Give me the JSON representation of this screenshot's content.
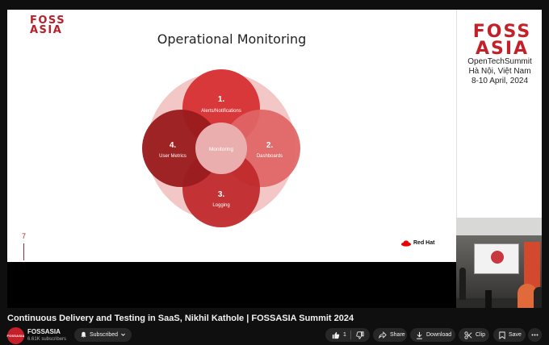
{
  "slide": {
    "logo": "FOSS\nASIA",
    "title": "Operational Monitoring",
    "slide_number": "7",
    "center_label": "Monitoring",
    "items": [
      {
        "num": "1.",
        "label": "Alerts/Notifications"
      },
      {
        "num": "2.",
        "label": "Dashboards"
      },
      {
        "num": "3.",
        "label": "Logging"
      },
      {
        "num": "4.",
        "label": "User Metrics"
      }
    ],
    "vendor_logo": "Red Hat"
  },
  "side_panel": {
    "logo": "FOSS\nASIA",
    "event_name": "OpenTechSummit",
    "location": "Hà Nội, Việt Nam",
    "dates": "8-10 April, 2024"
  },
  "video": {
    "title": "Continuous Delivery and Testing in SaaS, Nikhil Kathole | FOSSASIA Summit 2024"
  },
  "channel": {
    "avatar_text": "FOSSASIA",
    "name": "FOSSASIA",
    "subscribers": "6.61K subscribers",
    "subscribe_label": "Subscribed"
  },
  "actions": {
    "like_count": "1",
    "share_label": "Share",
    "download_label": "Download",
    "clip_label": "Clip",
    "save_label": "Save"
  },
  "colors": {
    "brand_red": "#c4202a",
    "bg_dark": "#0f0f0f",
    "pill_bg": "#272727"
  },
  "icons": {
    "subscribe": "bell-icon",
    "like": "thumbs-up-icon",
    "dislike": "thumbs-down-icon",
    "share": "share-arrow-icon",
    "download": "download-icon",
    "clip": "scissors-icon",
    "save": "bookmark-icon",
    "more": "more-dots-icon"
  }
}
